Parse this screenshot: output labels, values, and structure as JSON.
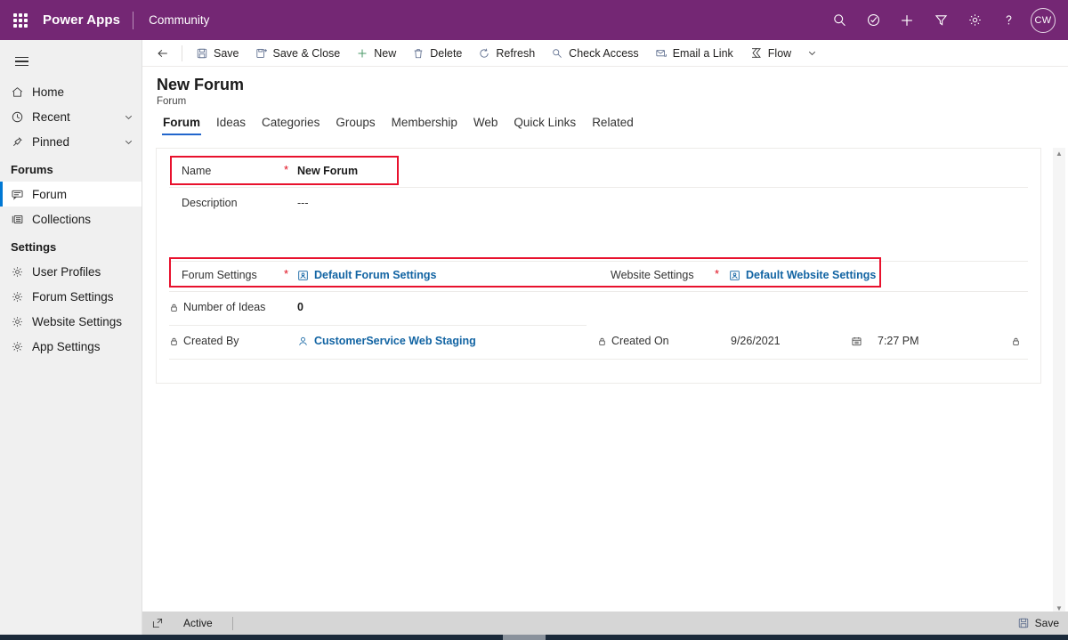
{
  "topbar": {
    "waffle_label": "app-launcher",
    "brand": "Power Apps",
    "environment": "Community",
    "icons": [
      "search-icon",
      "assistant-icon",
      "add-icon",
      "filter-icon",
      "settings-icon",
      "help-icon"
    ],
    "avatar_initials": "CW",
    "background": "#742774"
  },
  "sidebar": {
    "hamburger_label": "site-map-toggle",
    "items": [
      {
        "label": "Home",
        "icon": "home-icon",
        "expandable": false
      },
      {
        "label": "Recent",
        "icon": "clock-icon",
        "expandable": true
      },
      {
        "label": "Pinned",
        "icon": "pin-icon",
        "expandable": true
      }
    ],
    "groups": [
      {
        "title": "Forums",
        "items": [
          {
            "label": "Forum",
            "icon": "forum-icon",
            "selected": true
          },
          {
            "label": "Collections",
            "icon": "collections-icon",
            "selected": false
          }
        ]
      },
      {
        "title": "Settings",
        "items": [
          {
            "label": "User Profiles",
            "icon": "gear-icon",
            "selected": false
          },
          {
            "label": "Forum Settings",
            "icon": "gear-icon",
            "selected": false
          },
          {
            "label": "Website Settings",
            "icon": "gear-icon",
            "selected": false
          },
          {
            "label": "App Settings",
            "icon": "gear-icon",
            "selected": false
          }
        ]
      }
    ]
  },
  "commandbar": {
    "back_label": "back-icon",
    "buttons": [
      {
        "label": "Save",
        "icon": "save-icon"
      },
      {
        "label": "Save & Close",
        "icon": "save-close-icon"
      },
      {
        "label": "New",
        "icon": "plus-icon"
      },
      {
        "label": "Delete",
        "icon": "trash-icon"
      },
      {
        "label": "Refresh",
        "icon": "refresh-icon"
      },
      {
        "label": "Check Access",
        "icon": "key-icon"
      },
      {
        "label": "Email a Link",
        "icon": "email-icon"
      },
      {
        "label": "Flow",
        "icon": "flow-icon"
      }
    ],
    "overflow_label": "chevron-down-icon"
  },
  "page": {
    "title": "New Forum",
    "subtitle": "Forum",
    "tabs": [
      {
        "label": "Forum",
        "active": true
      },
      {
        "label": "Ideas",
        "active": false
      },
      {
        "label": "Categories",
        "active": false
      },
      {
        "label": "Groups",
        "active": false
      },
      {
        "label": "Membership",
        "active": false
      },
      {
        "label": "Web",
        "active": false
      },
      {
        "label": "Quick Links",
        "active": false
      },
      {
        "label": "Related",
        "active": false
      }
    ]
  },
  "form": {
    "name": {
      "label": "Name",
      "value": "New Forum",
      "required": true,
      "highlighted": true
    },
    "description": {
      "label": "Description",
      "value": "---",
      "required": false
    },
    "forum_settings": {
      "label": "Forum Settings",
      "value": "Default Forum Settings",
      "required": true,
      "icon": "record-icon",
      "highlighted": true
    },
    "website_settings": {
      "label": "Website Settings",
      "value": "Default Website Settings",
      "required": true,
      "icon": "record-icon",
      "highlighted": true
    },
    "number_of_ideas": {
      "label": "Number of Ideas",
      "value": "0",
      "readonly": true,
      "icon": "lock-icon"
    },
    "created_by": {
      "label": "Created By",
      "value": "CustomerService Web Staging",
      "readonly": true,
      "icon": "lock-icon",
      "value_icon": "person-icon"
    },
    "created_on": {
      "label": "Created On",
      "date": "9/26/2021",
      "time": "7:27 PM",
      "readonly": true,
      "icon": "lock-icon",
      "date_icon": "calendar-icon"
    },
    "highlight_color": "#e8112d"
  },
  "scrollbar": {
    "up": "▲",
    "down": "▼"
  },
  "statusbar": {
    "expand_icon": "popout-icon",
    "state": "Active",
    "save_label": "Save",
    "save_icon": "save-icon"
  }
}
